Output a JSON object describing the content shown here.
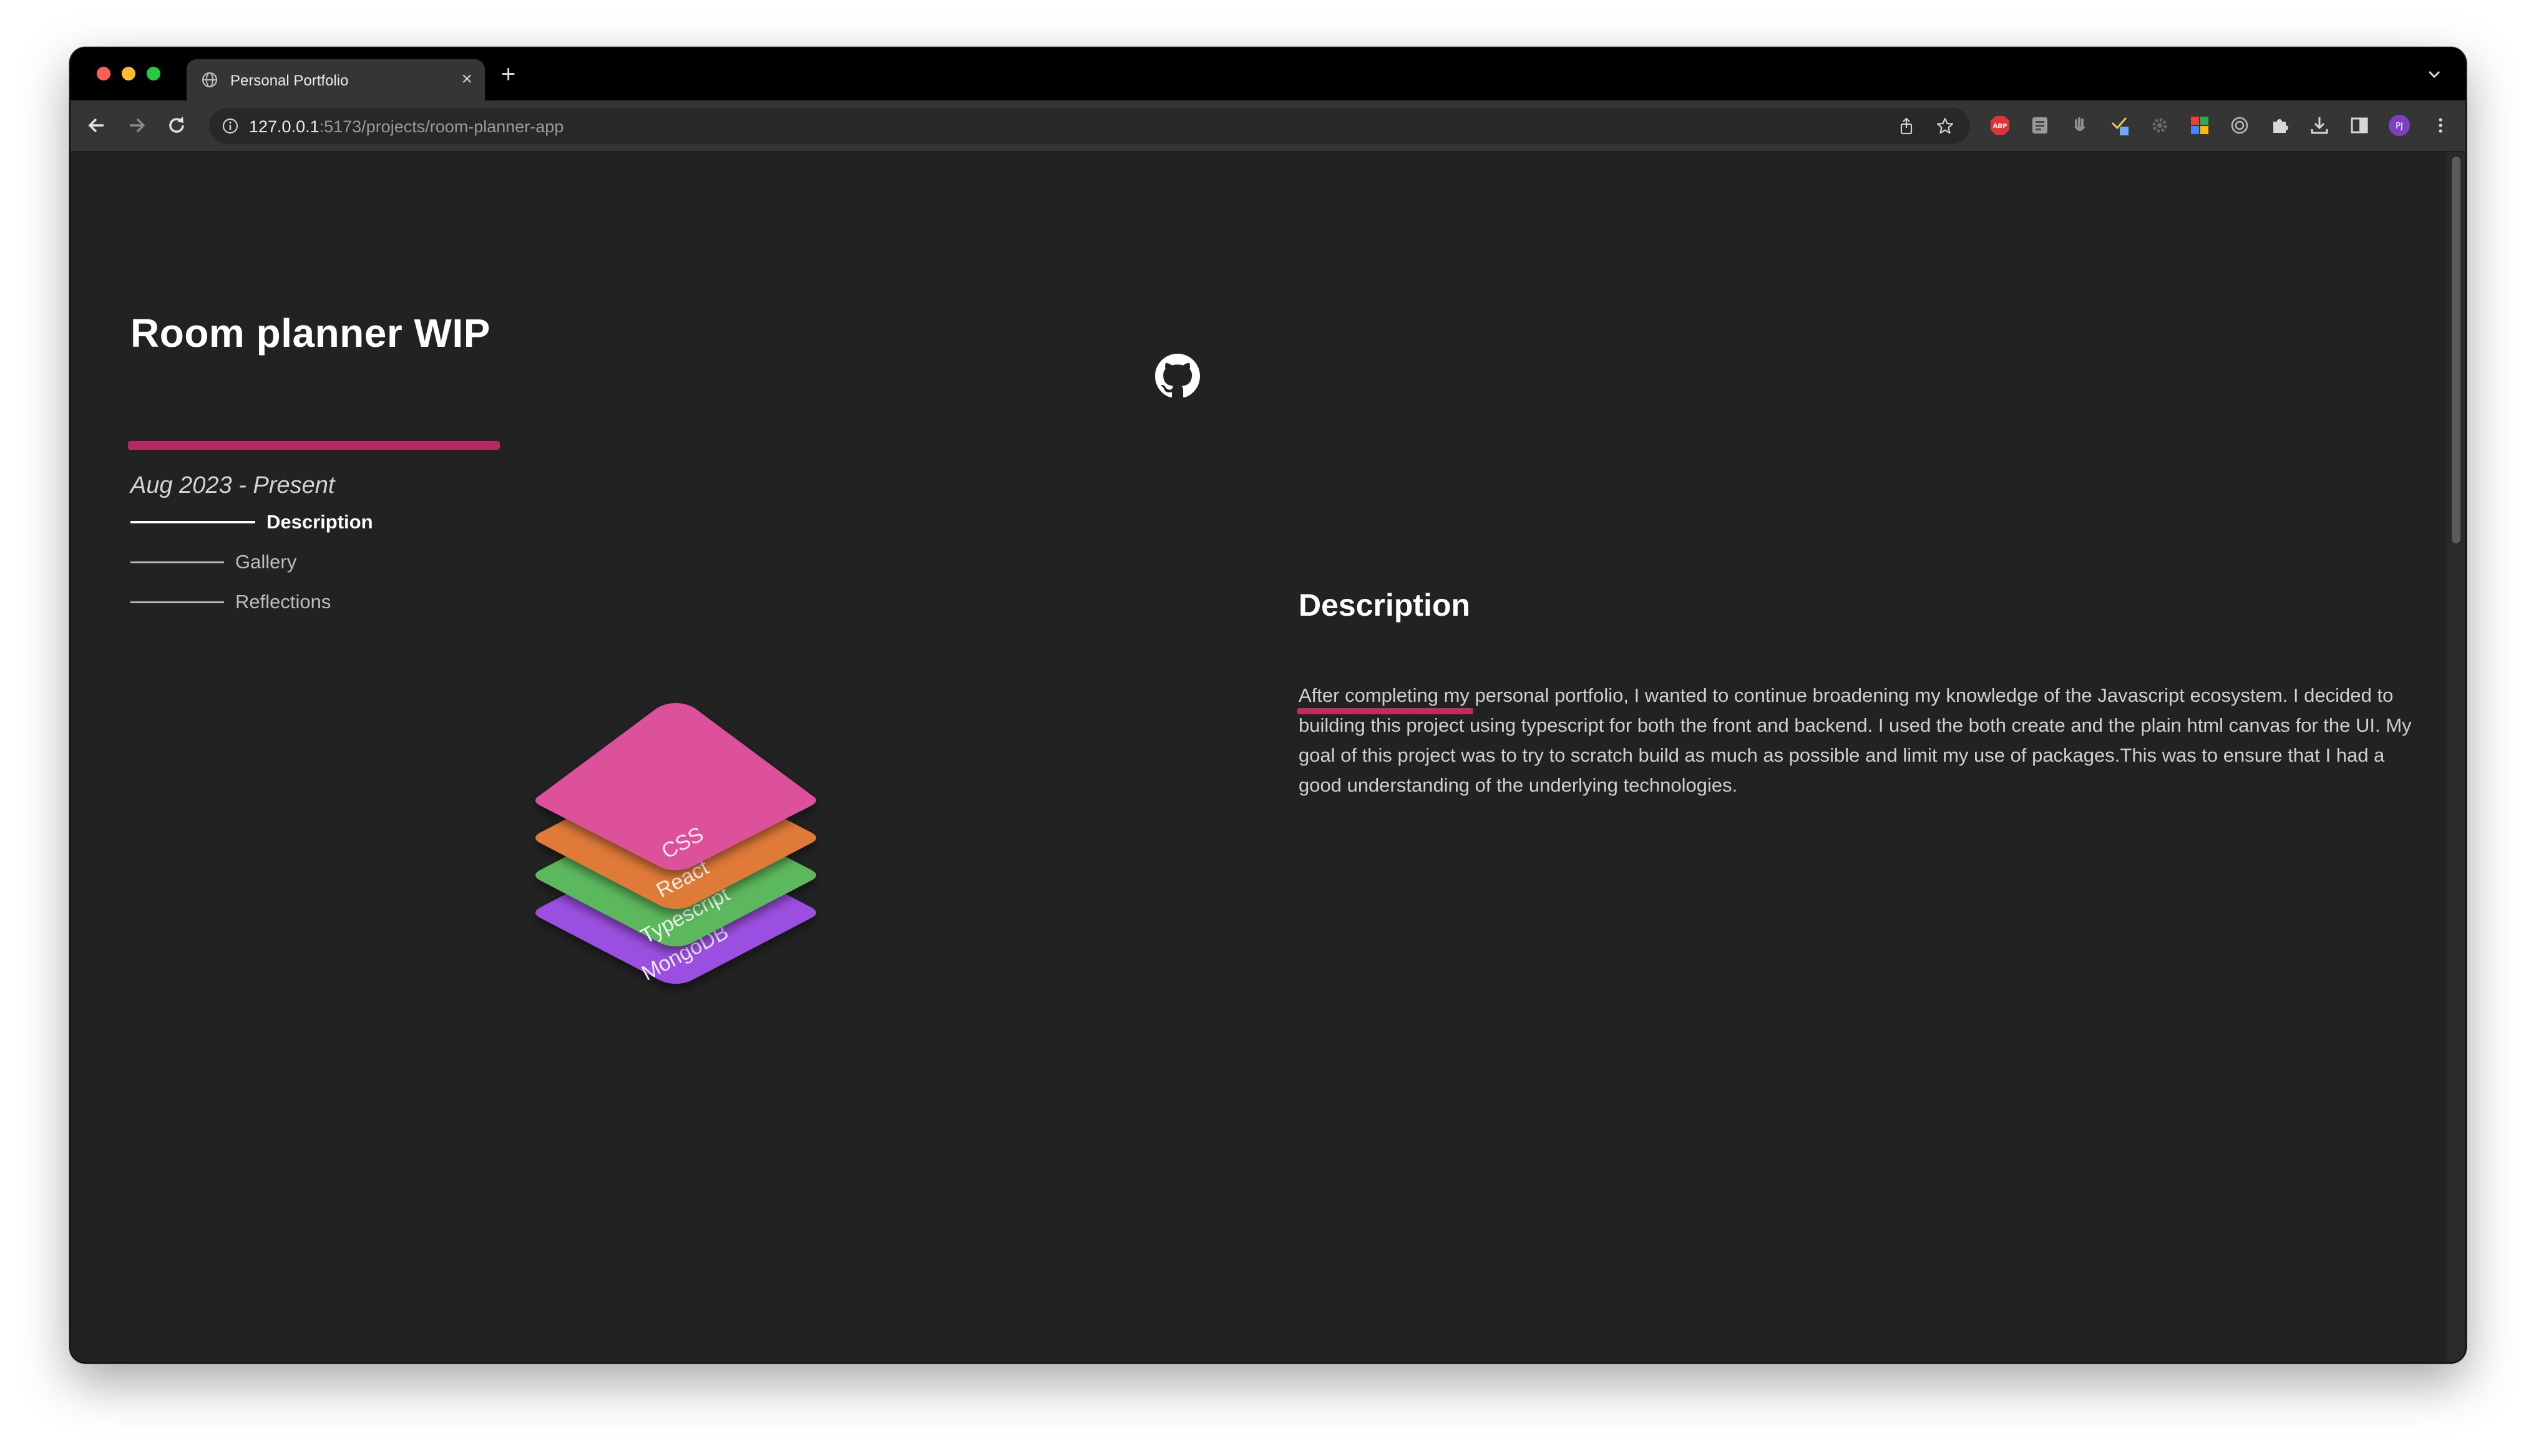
{
  "browser": {
    "tab_title": "Personal Portfolio",
    "tab_close": "×",
    "new_tab": "+",
    "url_host": "127.0.0.1",
    "url_path": ":5173/projects/room-planner-app",
    "profile_initials": "PJ",
    "extension_icons": [
      "adblock-icon",
      "reader-icon",
      "hand-icon",
      "eyedropper-icon",
      "gear-icon",
      "google-icon",
      "target-icon",
      "puzzle-icon",
      "download-icon",
      "sidepanel-icon"
    ]
  },
  "project": {
    "title": "Room planner WIP",
    "date": "Aug 2023 - Present"
  },
  "toc": {
    "items": [
      {
        "label": "Description",
        "active": true
      },
      {
        "label": "Gallery",
        "active": false
      },
      {
        "label": "Reflections",
        "active": false
      }
    ]
  },
  "tech_stack": {
    "layers": [
      {
        "label": "CSS",
        "color": "#dc519a"
      },
      {
        "label": "React",
        "color": "#e07a37"
      },
      {
        "label": "Typescript",
        "color": "#5cb85c"
      },
      {
        "label": "MongoDB",
        "color": "#9b4fe0"
      }
    ]
  },
  "description": {
    "heading": "Description",
    "text": "After completing my personal portfolio, I wanted to continue broadening my knowledge of the Javascript ecosystem. I decided to building this project using typescript for both the front and backend. I used the both create and the plain html canvas for the UI. My goal of this project was to try to scratch build as much as possible and limit my use of packages.This was to ensure that I had a good understanding of the underlying technologies."
  },
  "colors": {
    "accent_underline": "#c22a63",
    "page_background": "#222222"
  }
}
